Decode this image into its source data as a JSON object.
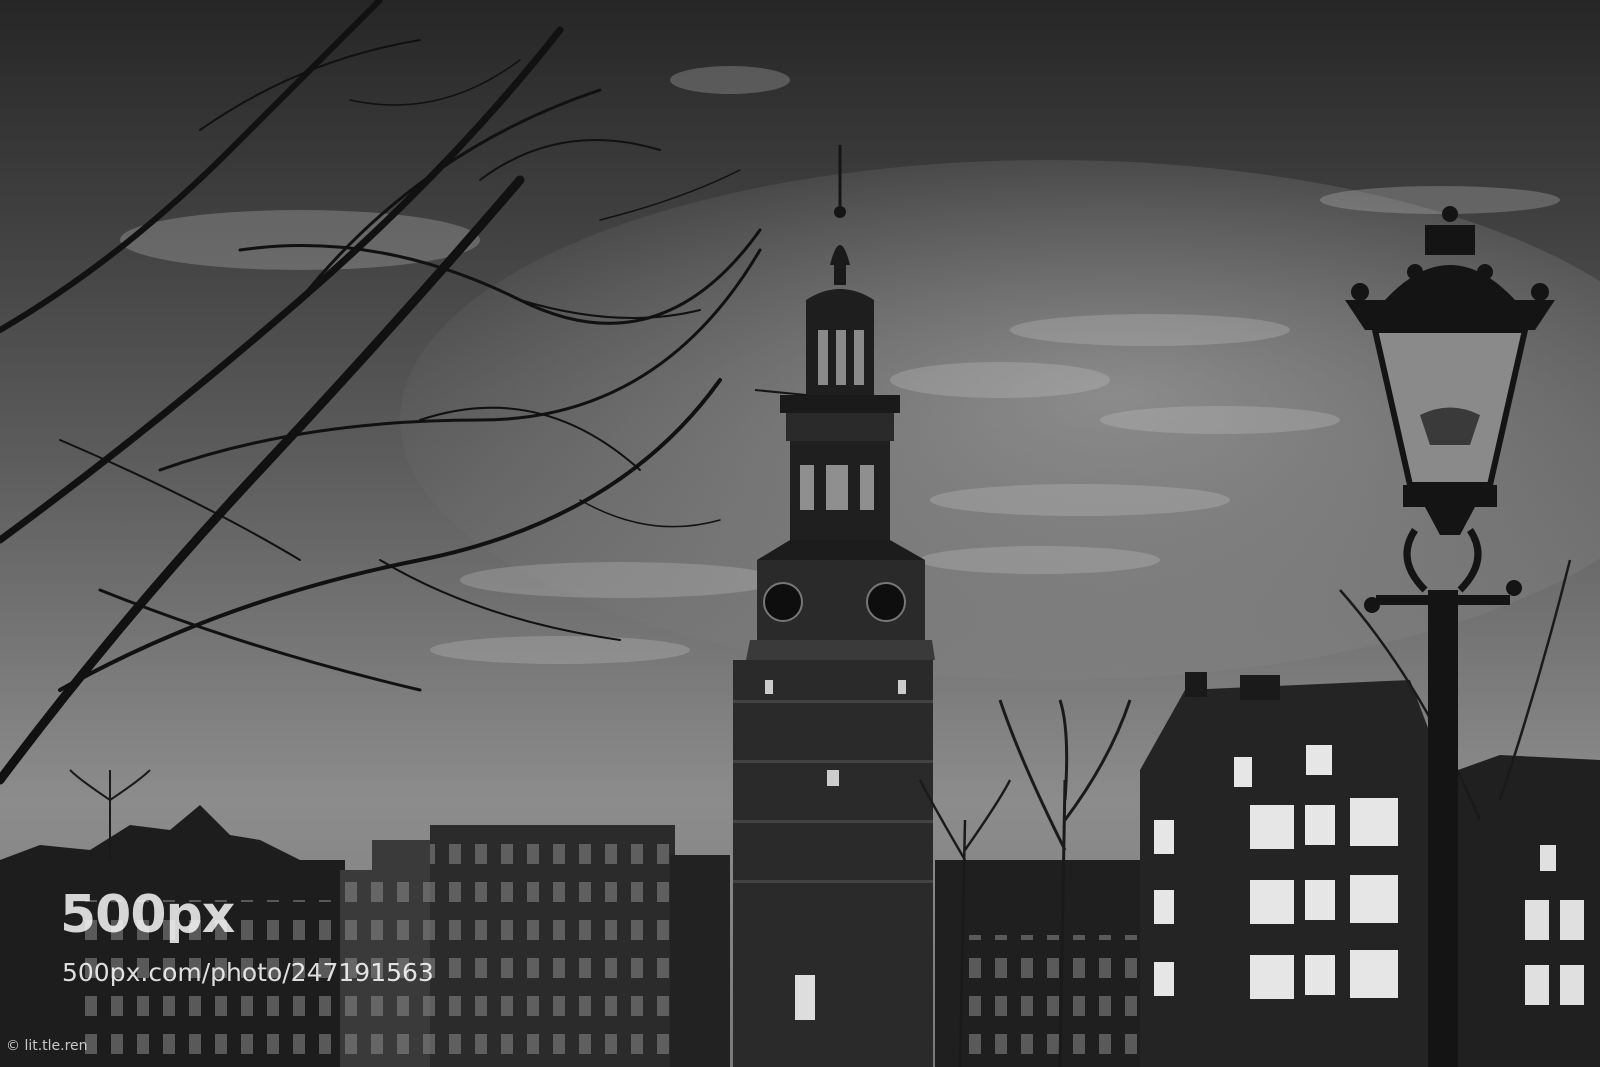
{
  "watermark": {
    "logo_text": "500px",
    "url_text": "500px.com/photo/247191563"
  },
  "credit": {
    "text": "© lit.tle.ren"
  },
  "colors": {
    "sky_top": "#2a2a2a",
    "sky_mid": "#6e6e6e",
    "sky_low": "#9a9a9a",
    "silhouette": "#151515",
    "building": "#262626",
    "tower": "#2e2e2e",
    "window": "#d8d8d8"
  }
}
